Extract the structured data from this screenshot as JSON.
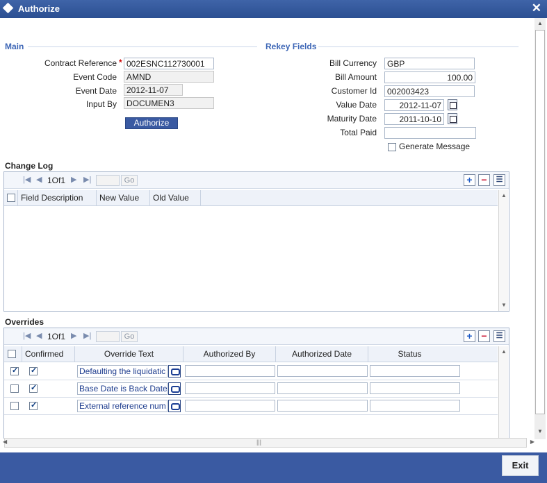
{
  "window": {
    "title": "Authorize"
  },
  "main": {
    "section_title": "Main",
    "contract_reference_label": "Contract Reference",
    "contract_reference_value": "002ESNC112730001",
    "event_code_label": "Event Code",
    "event_code_value": "AMND",
    "event_date_label": "Event Date",
    "event_date_value": "2012-11-07",
    "input_by_label": "Input By",
    "input_by_value": "DOCUMEN3",
    "authorize_button": "Authorize"
  },
  "rekey": {
    "section_title": "Rekey Fields",
    "bill_currency_label": "Bill Currency",
    "bill_currency_value": "GBP",
    "bill_amount_label": "Bill Amount",
    "bill_amount_value": "100.00",
    "customer_id_label": "Customer Id",
    "customer_id_value": "002003423",
    "value_date_label": "Value Date",
    "value_date_value": "2012-11-07",
    "maturity_date_label": "Maturity Date",
    "maturity_date_value": "2011-10-10",
    "total_paid_label": "Total Paid",
    "total_paid_value": "",
    "generate_message_label": "Generate Message"
  },
  "change_log": {
    "title": "Change Log",
    "page_info": "1Of1",
    "go_label": "Go",
    "columns": [
      "Field Description",
      "New Value",
      "Old Value"
    ]
  },
  "overrides": {
    "title": "Overrides",
    "page_info": "1Of1",
    "go_label": "Go",
    "columns": [
      "Confirmed",
      "Override Text",
      "Authorized By",
      "Authorized Date",
      "Status"
    ],
    "rows": [
      {
        "text": "Defaulting the liquidatic"
      },
      {
        "text": "Base Date is Back Date"
      },
      {
        "text": "External reference num"
      }
    ]
  },
  "footer": {
    "exit_label": "Exit"
  }
}
